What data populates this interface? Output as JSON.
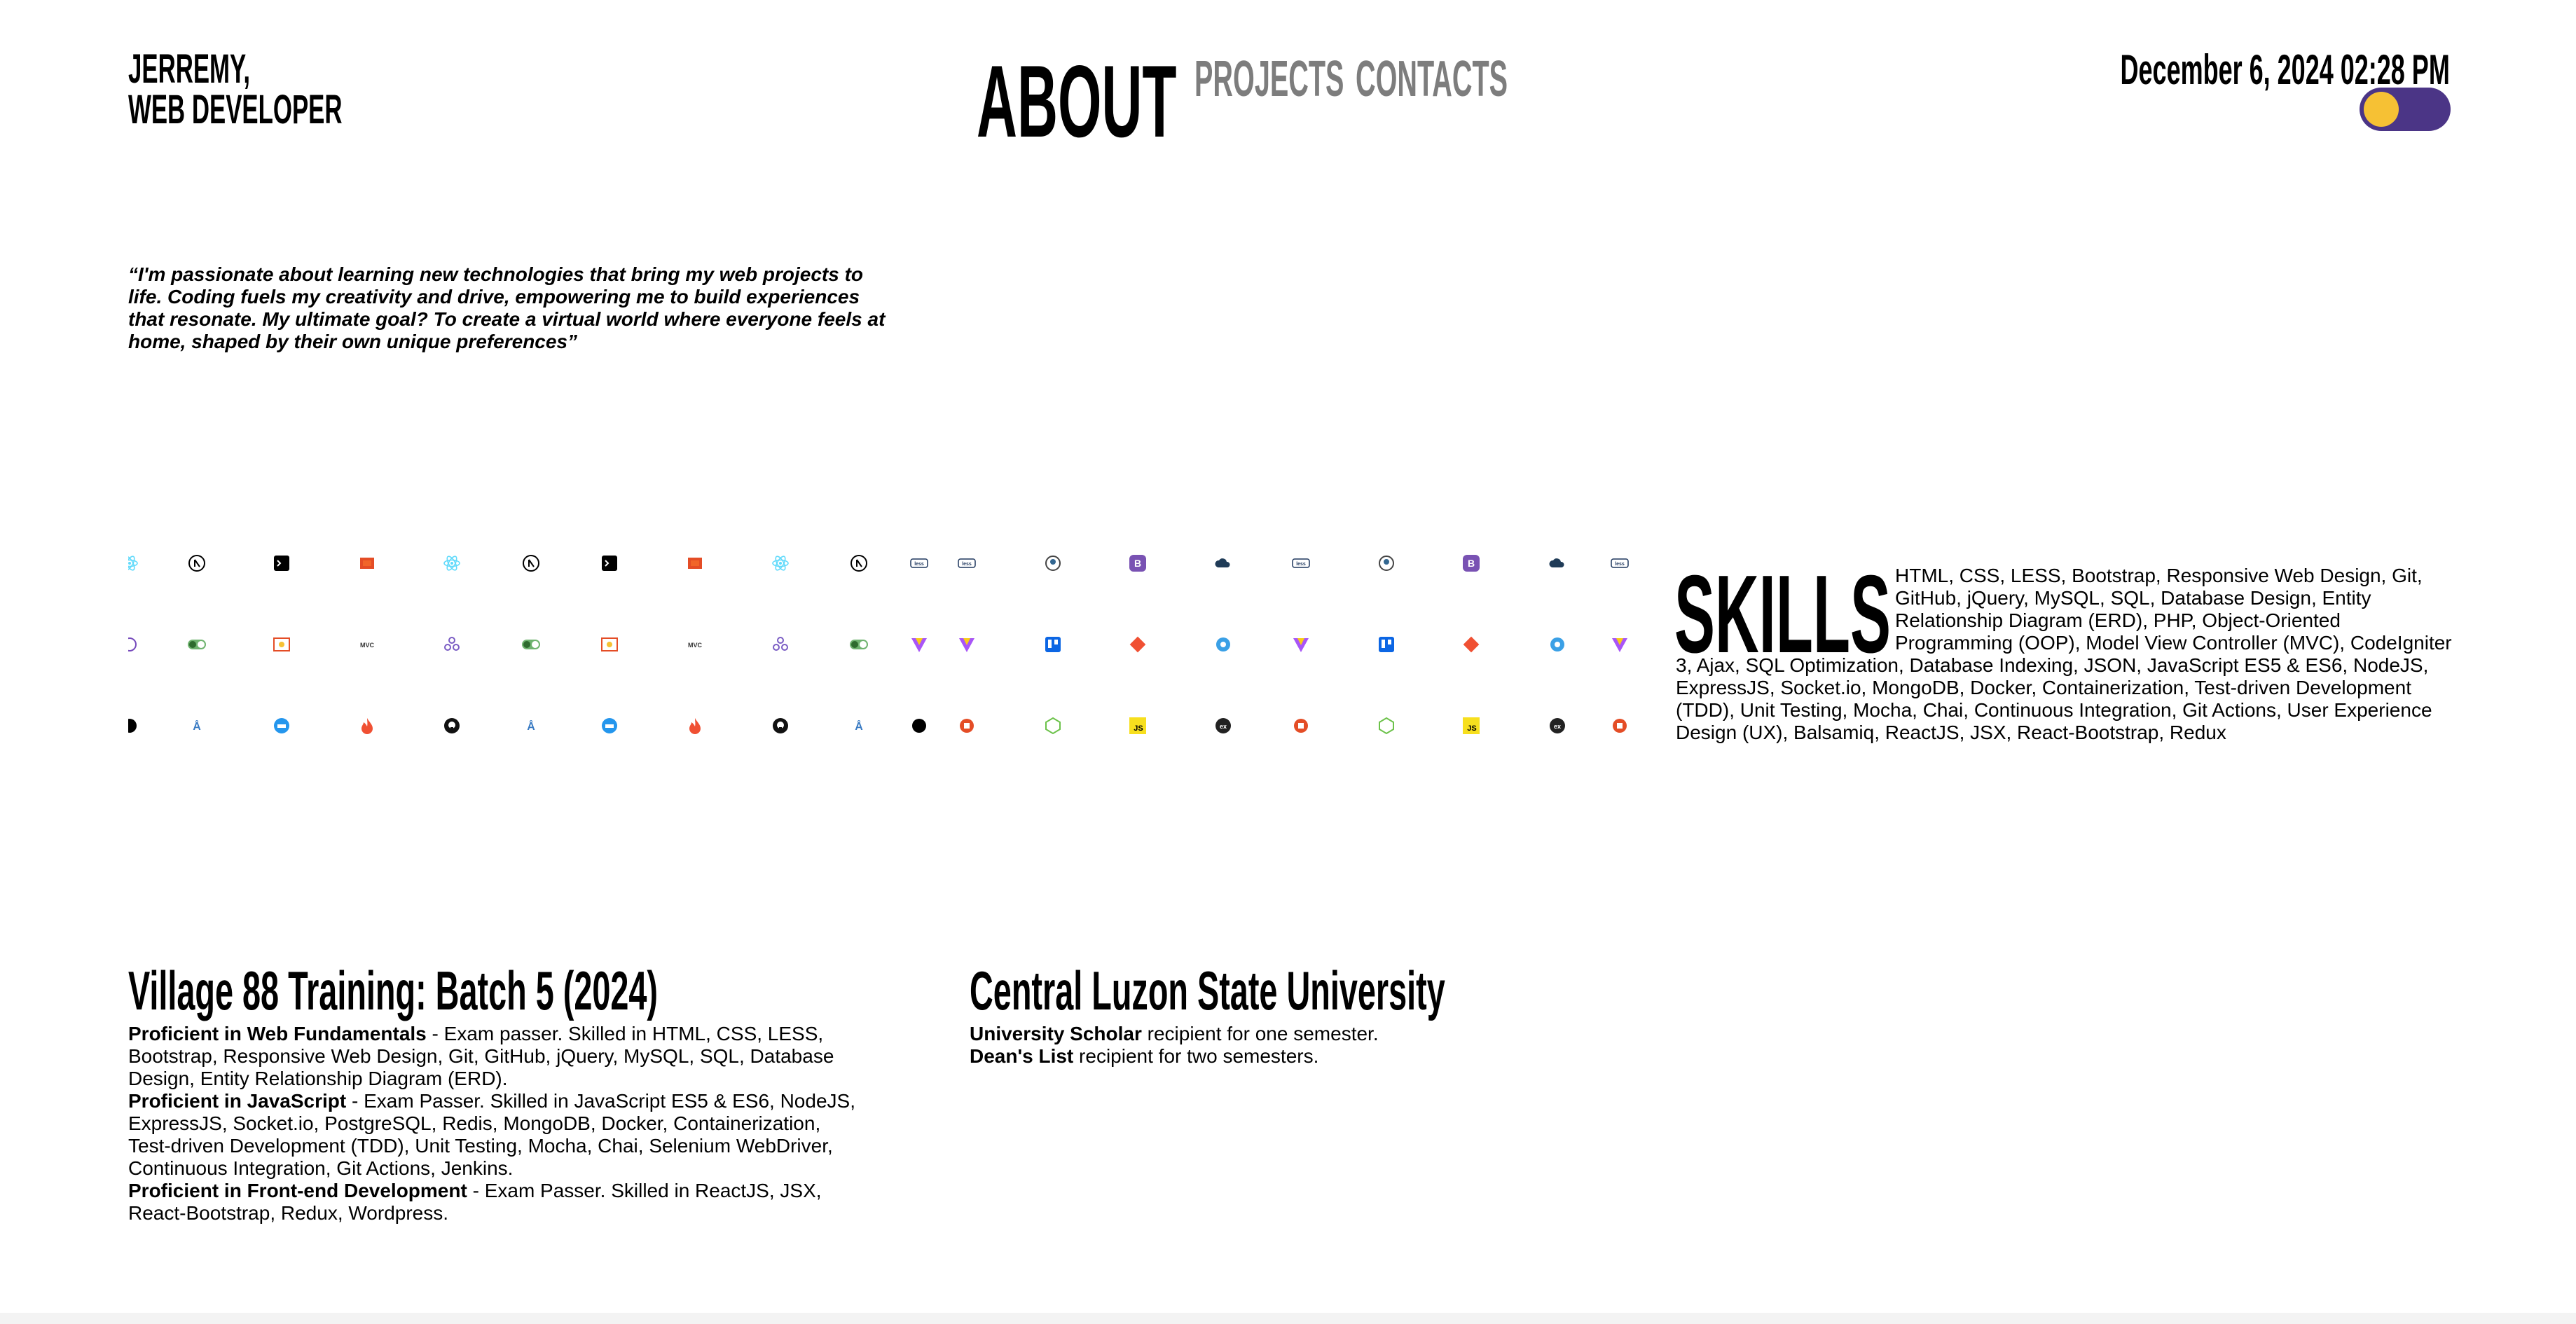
{
  "header": {
    "name_line1": "JERREMY,",
    "name_line2": "WEB DEVELOPER",
    "nav": {
      "about": "ABOUT",
      "projects": "PROJECTS",
      "contacts": "CONTACTS"
    },
    "datetime": "December 6, 2024 02:28 PM",
    "toggle_colors": {
      "track": "#4b3586",
      "knob": "#f6c134"
    }
  },
  "quote": "“I'm passionate about learning new technologies that bring my web projects to life. Coding fuels my creativity and drive, empowering me to build experiences that resonate. My ultimate goal? To create a virtual world where everyone feels at home, shaped by their own unique preferences”",
  "icon_rows": [
    [
      "react-icon",
      "nextjs-icon",
      "terminal-icon",
      "html5-icon",
      "react-icon",
      "nextjs-icon",
      "terminal-icon",
      "html5-icon",
      "react-icon",
      "nextjs-icon",
      "less-icon",
      "less-icon",
      "postgresql-icon",
      "bootstrap-icon",
      "cloud-icon",
      "less-icon",
      "postgresql-icon",
      "bootstrap-icon",
      "cloud-icon",
      "less-icon"
    ],
    [
      "redux-icon",
      "toggle-on-icon",
      "erd-icon",
      "mvc-icon",
      "git-actions-icon",
      "toggle-on-icon",
      "erd-icon",
      "mvc-icon",
      "git-actions-icon",
      "toggle-on-icon",
      "vite-icon",
      "vite-icon",
      "trello-icon",
      "git-icon",
      "socketio-icon",
      "vite-icon",
      "trello-icon",
      "git-icon",
      "socketio-icon",
      "vite-icon"
    ],
    [
      "dark-circle-icon",
      "selenium-icon",
      "docker-icon",
      "firebase-icon",
      "github-icon",
      "selenium-icon",
      "docker-icon",
      "firebase-icon",
      "github-icon",
      "selenium-icon",
      "dark-circle-icon",
      "html5-badge-icon",
      "nodejs-icon",
      "javascript-icon",
      "express-icon",
      "html5-badge-icon",
      "nodejs-icon",
      "javascript-icon",
      "express-icon",
      "html5-badge-icon"
    ]
  ],
  "skills": {
    "title": "SKILLS",
    "text": "HTML, CSS, LESS, Bootstrap, Responsive Web Design, Git, GitHub, jQuery, MySQL, SQL, Database Design, Entity Relationship Diagram (ERD), PHP, Object-Oriented Programming (OOP), Model View Controller (MVC), CodeIgniter 3, Ajax, SQL Optimization, Database Indexing, JSON, JavaScript ES5 & ES6, NodeJS, ExpressJS, Socket.io, MongoDB, Docker, Containerization, Test-driven Development (TDD), Unit Testing, Mocha, Chai, Continuous Integration, Git Actions, User Experience Design (UX), Balsamiq, ReactJS, JSX, React-Bootstrap, Redux"
  },
  "education": [
    {
      "title": "Village 88 Training: Batch 5 (2024)",
      "items": [
        {
          "bold": "Proficient in Web Fundamentals",
          "text": " - Exam passer. Skilled in HTML, CSS, LESS, Bootstrap, Responsive Web Design, Git, GitHub, jQuery, MySQL, SQL, Database Design, Entity Relationship Diagram (ERD)."
        },
        {
          "bold": "Proficient in JavaScript",
          "text": " - Exam Passer. Skilled in JavaScript ES5 & ES6, NodeJS, ExpressJS, Socket.io, PostgreSQL, Redis, MongoDB, Docker, Containerization, Test-driven Development (TDD), Unit Testing, Mocha, Chai, Selenium WebDriver, Continuous Integration, Git Actions, Jenkins."
        },
        {
          "bold": "Proficient in Front-end Development",
          "text": " - Exam Passer. Skilled in ReactJS, JSX, React-Bootstrap, Redux, Wordpress."
        }
      ]
    },
    {
      "title": "Central Luzon State University",
      "items": [
        {
          "bold": "University Scholar",
          "text": " recipient for one semester."
        },
        {
          "bold": "Dean's List",
          "text": " recipient for two semesters."
        }
      ]
    }
  ]
}
